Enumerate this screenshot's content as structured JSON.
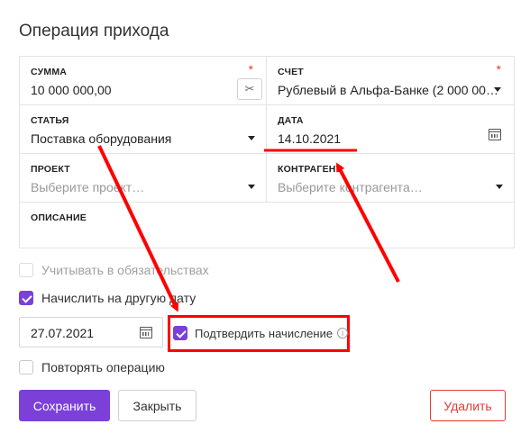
{
  "page": {
    "title": "Операция прихода"
  },
  "fields": {
    "amount": {
      "label": "СУММА",
      "value": "10 000 000,00",
      "required_mark": "*"
    },
    "account": {
      "label": "СЧЕТ",
      "value": "Рублевый в Альфа-Банке (2 000 00…",
      "required_mark": "*"
    },
    "item": {
      "label": "СТАТЬЯ",
      "value": "Поставка оборудования"
    },
    "date": {
      "label": "ДАТА",
      "value": "14.10.2021"
    },
    "project": {
      "label": "ПРОЕКТ",
      "placeholder": "Выберите проект…"
    },
    "counterparty": {
      "label": "КОНТРАГЕНТ",
      "placeholder": "Выберите контрагента…"
    },
    "description": {
      "label": "ОПИСАНИЕ"
    }
  },
  "options": {
    "include_obligations": {
      "label": "Учитывать в обязательствах",
      "checked": false,
      "disabled": true
    },
    "accrue_other_date": {
      "label": "Начислить на другую дату",
      "checked": true
    },
    "accrual_date": "27.07.2021",
    "confirm_accrual": {
      "label": "Подтвердить начисление",
      "checked": true
    },
    "repeat": {
      "label": "Повторять операцию",
      "checked": false
    }
  },
  "buttons": {
    "save": "Сохранить",
    "close": "Закрыть",
    "delete": "Удалить"
  },
  "colors": {
    "accent": "#7b40d8",
    "danger": "#e53935",
    "annotation": "#ff0000"
  },
  "icons": {
    "cut": "scissors-icon",
    "calendar": "calendar-icon",
    "dropdown": "caret-down-icon",
    "info": "info-icon"
  }
}
